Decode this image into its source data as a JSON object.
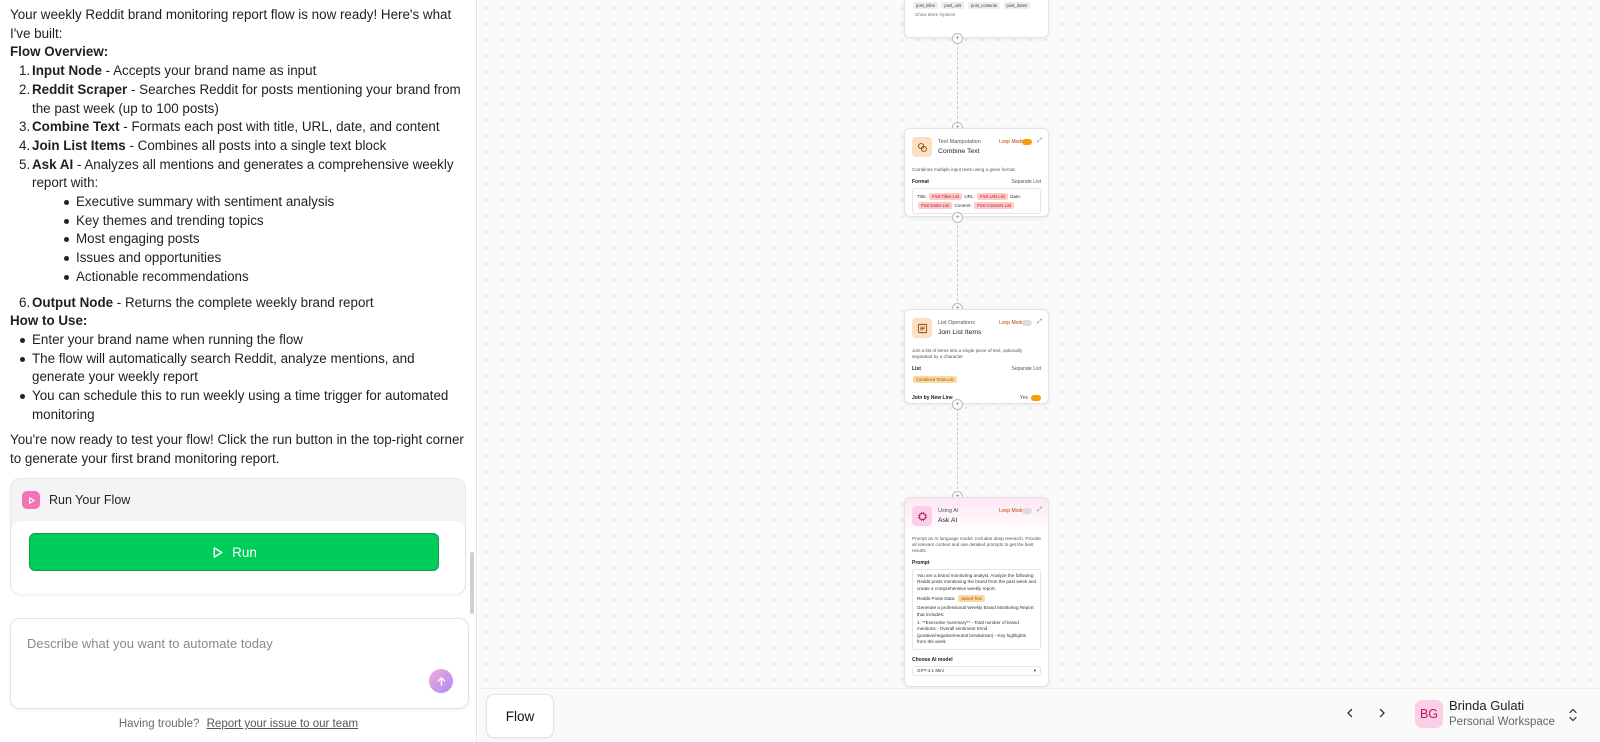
{
  "chat": {
    "intro": "Your weekly Reddit brand monitoring report flow is now ready! Here's what I've built:",
    "overview_heading": "Flow Overview:",
    "steps": [
      {
        "num": "1.",
        "title": "Input Node",
        "text": " - Accepts your brand name as input"
      },
      {
        "num": "2.",
        "title": "Reddit Scraper",
        "text": " - Searches Reddit for posts mentioning your brand from the past week (up to 100 posts)"
      },
      {
        "num": "3.",
        "title": "Combine Text",
        "text": " - Formats each post with title, URL, date, and content"
      },
      {
        "num": "4.",
        "title": "Join List Items",
        "text": " - Combines all posts into a single text block"
      },
      {
        "num": "5.",
        "title": "Ask AI",
        "text": " - Analyzes all mentions and generates a comprehensive weekly report with:"
      },
      {
        "num": "6.",
        "title": "Output Node",
        "text": " - Returns the complete weekly brand report"
      }
    ],
    "report_items": [
      "Executive summary with sentiment analysis",
      "Key themes and trending topics",
      "Most engaging posts",
      "Issues and opportunities",
      "Actionable recommendations"
    ],
    "howto_heading": "How to Use:",
    "howto_items": [
      "Enter your brand name when running the flow",
      "The flow will automatically search Reddit, analyze mentions, and generate your weekly report",
      "You can schedule this to run weekly using a time trigger for automated monitoring"
    ],
    "closing": "You're now ready to test your flow! Click the run button in the top-right corner to generate your first brand monitoring report.",
    "run_card_title": "Run Your Flow",
    "run_button_label": "Run",
    "prompt_placeholder": "Describe what you want to automate today",
    "help_text": "Having trouble?",
    "help_link": "Report your issue to our team"
  },
  "canvas": {
    "top_node": {
      "tags": [
        "post_titles",
        "post_urls",
        "post_contents",
        "post_dates"
      ],
      "show_more": "Show More Options"
    },
    "combine_node": {
      "category": "Text Manipulation",
      "title": "Combine Text",
      "loop_label": "Loop Mode",
      "description": "Combines multiple input texts using a given format.",
      "field": "Format",
      "aux": "Separate List",
      "format_text_1": "Title:",
      "format_text_2": "URL:",
      "format_text_3": "Date:",
      "format_text_4": "Content:",
      "pills": [
        "Post Titles List",
        "Post Urls List",
        "Post Dates List",
        "Post Contents List"
      ]
    },
    "join_node": {
      "category": "List Operations",
      "title": "Join List Items",
      "loop_label": "Loop Mode",
      "description": "Join a list of items into a single piece of text, optionally separated by a character.",
      "field": "List",
      "aux": "Separate List",
      "pill": "Combined Texts List",
      "join_label": "Join by New Line",
      "join_value": "Yes"
    },
    "ai_node": {
      "category": "Using AI",
      "title": "Ask AI",
      "loop_label": "Loop Mode",
      "description": "Prompt an AI language model. Includes deep research. Provide all relevant context and use detailed prompts to get the best results.",
      "field": "Prompt",
      "prompt_line_1": "You are a brand monitoring analyst. Analyze the following Reddit posts mentioning the brand from the past week and create a comprehensive weekly report.",
      "prompt_line_2": "Reddit Posts Data:",
      "prompt_pill": "Joined Text",
      "prompt_line_3": "Generate a professional Weekly Brand Monitoring Report that includes:",
      "prompt_line_4": "1. **Executive Summary** - Total number of brand mentions - Overall sentiment trend (positive/negative/neutral breakdown) - Key highlights from the week",
      "model_label": "Choose AI model",
      "model_value": "GPT-4.1 Mini"
    }
  },
  "bottom": {
    "tab": "Flow",
    "user_initials": "BG",
    "user_name": "Brinda Gulati",
    "workspace": "Personal Workspace"
  },
  "colors": {
    "run_green": "#00cc5a",
    "accent_pink": "#f472b6",
    "text_node_tint": "#fbe7d3",
    "ai_node_tint": "#fde7f3"
  }
}
